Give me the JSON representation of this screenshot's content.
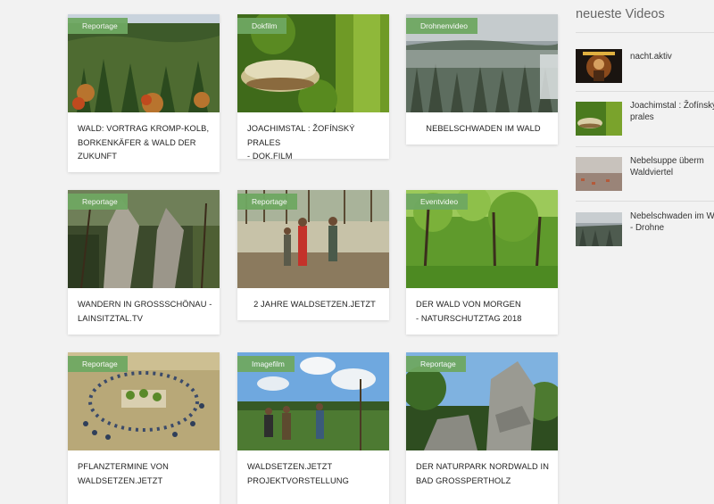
{
  "cards": [
    {
      "badge": "Reportage",
      "title": "WALD: VORTRAG KROMP-KOLB,\nBORKENKÄFER & WALD DER\nZUKUNFT"
    },
    {
      "badge": "Dokfilm",
      "title": "JOACHIMSTAL : ŽOFÍNSKÝ PRALES\n- DOK.FILM"
    },
    {
      "badge": "Drohnenvideo",
      "title": "NEBELSCHWADEN IM WALD"
    },
    {
      "badge": "Reportage",
      "title": "WANDERN IN GROSSSCHÖNAU -\nLAINSITZTAL.TV"
    },
    {
      "badge": "Reportage",
      "title": "2 JAHRE WALDSETZEN.JETZT"
    },
    {
      "badge": "Eventvideo",
      "title": "DER WALD VON MORGEN\n- NATURSCHUTZTAG 2018"
    },
    {
      "badge": "Reportage",
      "title": "PFLANZTERMINE VON\nWALDSETZEN.JETZT"
    },
    {
      "badge": "Imagefilm",
      "title": "WALDSETZEN.JETZT\nPROJEKTVORSTELLUNG"
    },
    {
      "badge": "Reportage",
      "title": "DER NATURPARK NORDWALD IN\nBAD GROSSPERTHOLZ"
    }
  ],
  "sidebar": {
    "title": "neueste Videos",
    "items": [
      {
        "label": "nacht.aktiv"
      },
      {
        "label": "Joachimstal : Žofínský\nprales"
      },
      {
        "label": "Nebelsuppe überm\nWaldviertel"
      },
      {
        "label": "Nebelschwaden im W\n- Drohne"
      }
    ]
  }
}
